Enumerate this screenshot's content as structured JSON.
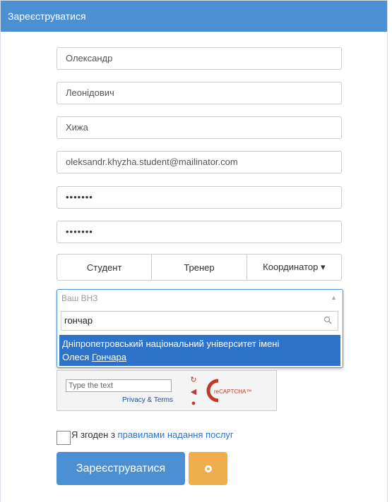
{
  "header": {
    "title": "Зареєструватися"
  },
  "form": {
    "first_name": "Олександр",
    "middle_name": "Леонідович",
    "last_name": "Хижа",
    "email": "oleksandr.khyzha.student@mailinator.com",
    "password": "•••••••",
    "password_confirm": "•••••••"
  },
  "roles": [
    "Студент",
    "Тренер",
    "Координатор ▾"
  ],
  "university": {
    "placeholder": "Ваш ВНЗ",
    "search_value": "гончар",
    "result_line1": "Дніпропетровський національний університет імені",
    "result_line2_prefix": "Олеся ",
    "result_line2_match": "Гончара"
  },
  "captcha": {
    "input_placeholder": "Type the text",
    "links": "Privacy & Terms",
    "logo_text": "reCAPTCHA™"
  },
  "agreement": {
    "text_prefix": "Я згоден з ",
    "link_text": "правилами надання послуг"
  },
  "buttons": {
    "register": "Зареєструватися"
  },
  "colors": {
    "primary": "#4a90d3",
    "warning": "#f0ad4e",
    "selected": "#2d73c9"
  }
}
